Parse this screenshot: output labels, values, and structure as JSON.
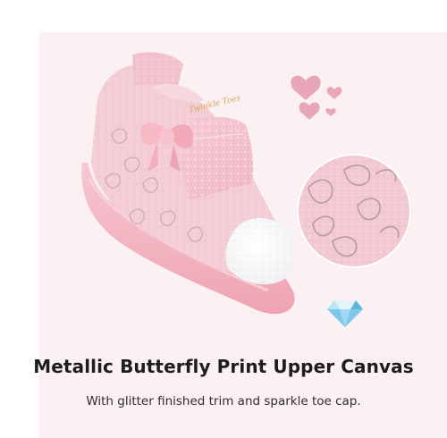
{
  "product": {
    "headline": "Metallic Butterfly Print Upper Canvas",
    "description": "With glitter finished trim and sparkle toe cap.",
    "brand_script": "Twinkle Toes"
  },
  "icons": [
    "heart-icon",
    "diamond-icon"
  ],
  "colors": {
    "panel": "#fbf1f3",
    "shoe_pink": "#f2c6cf",
    "sole_pink": "#f4b6c3",
    "heart_pink": "#e8a6b6",
    "title_text": "#1d1d1d"
  }
}
